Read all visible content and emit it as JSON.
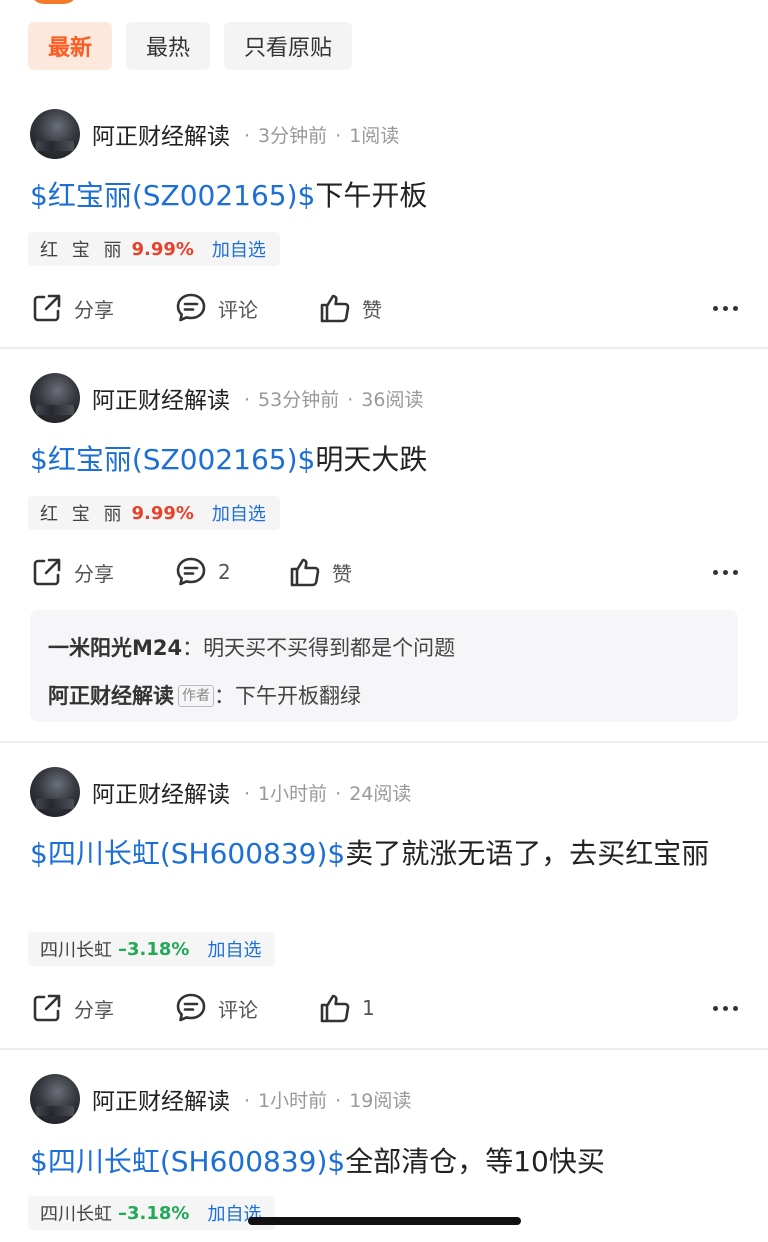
{
  "tabs": [
    {
      "label": "最新",
      "active": true
    },
    {
      "label": "最热",
      "active": false
    },
    {
      "label": "只看原贴",
      "active": false
    }
  ],
  "posts": [
    {
      "author": "阿正财经解读",
      "time": "3分钟前",
      "reads": "1阅读",
      "stock_link": "$红宝丽(SZ002165)$",
      "text": "下午开板",
      "tag": {
        "name": "红 宝 丽",
        "change": "9.99%",
        "direction": "up",
        "add": "加自选"
      },
      "actions": {
        "share": "分享",
        "comment": "评论",
        "like": "赞"
      }
    },
    {
      "author": "阿正财经解读",
      "time": "53分钟前",
      "reads": "36阅读",
      "stock_link": "$红宝丽(SZ002165)$",
      "text": "明天大跌",
      "tag": {
        "name": "红 宝 丽",
        "change": "9.99%",
        "direction": "up",
        "add": "加自选"
      },
      "actions": {
        "share": "分享",
        "comment": "2",
        "like": "赞"
      },
      "comments": [
        {
          "name": "一米阳光M24",
          "badge": "",
          "sep": "：",
          "text": "明天买不买得到都是个问题"
        },
        {
          "name": "阿正财经解读",
          "badge": "作者",
          "sep": "：",
          "text": "下午开板翻绿"
        }
      ]
    },
    {
      "author": "阿正财经解读",
      "time": "1小时前",
      "reads": "24阅读",
      "stock_link": "$四川长虹(SH600839)$",
      "text": "卖了就涨无语了，去买红宝丽",
      "tag": {
        "name": "四川长虹",
        "change": "–3.18%",
        "direction": "down",
        "add": "加自选"
      },
      "actions": {
        "share": "分享",
        "comment": "评论",
        "like": "1"
      }
    },
    {
      "author": "阿正财经解读",
      "time": "1小时前",
      "reads": "19阅读",
      "stock_link": "$四川长虹(SH600839)$",
      "text": "全部清仓，等10快买",
      "tag": {
        "name": "四川长虹",
        "change": "–3.18%",
        "direction": "down",
        "add": "加自选"
      }
    }
  ],
  "colors": {
    "accent": "#ff5a1f",
    "link": "#1d6fd8",
    "up": "#e8402a",
    "down": "#23a758"
  }
}
